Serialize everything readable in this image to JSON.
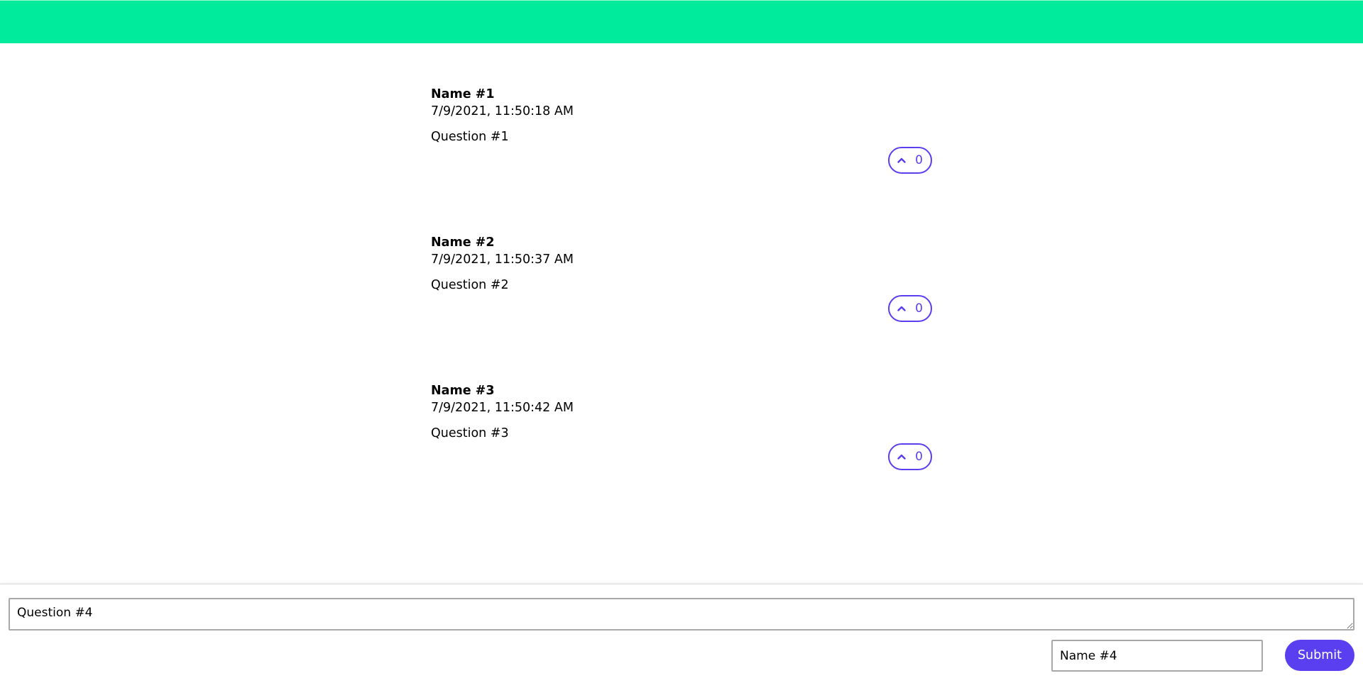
{
  "colors": {
    "header_bar": "#00eb9b",
    "accent": "#5a3ff0"
  },
  "questions": [
    {
      "name": "Name #1",
      "time": "7/9/2021, 11:50:18 AM",
      "text": "Question #1",
      "votes": "0",
      "vote_icon": "chevron-up-icon"
    },
    {
      "name": "Name #2",
      "time": "7/9/2021, 11:50:37 AM",
      "text": "Question #2",
      "votes": "0",
      "vote_icon": "chevron-up-icon"
    },
    {
      "name": "Name #3",
      "time": "7/9/2021, 11:50:42 AM",
      "text": "Question #3",
      "votes": "0",
      "vote_icon": "chevron-up-icon"
    }
  ],
  "composer": {
    "question_value": "Question #4",
    "name_value": "Name #4",
    "submit_label": "Submit"
  }
}
